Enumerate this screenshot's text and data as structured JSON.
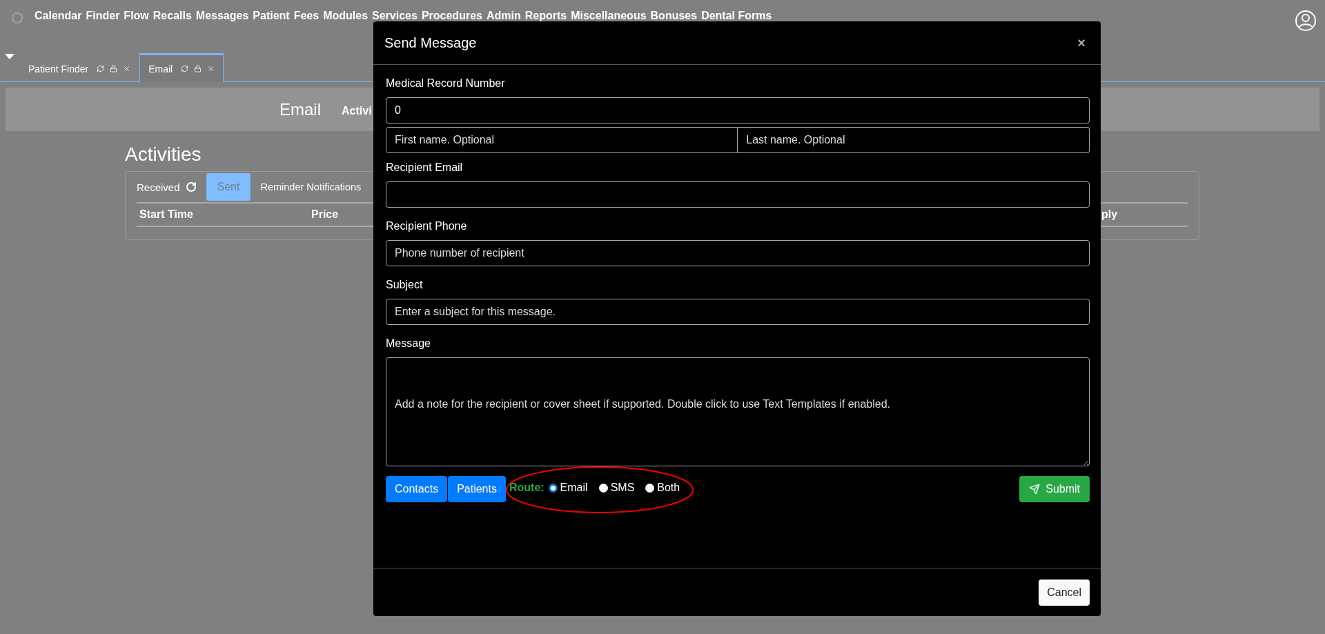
{
  "nav": {
    "items": [
      "Calendar",
      "Finder",
      "Flow",
      "Recalls",
      "Messages",
      "Patient",
      "Fees",
      "Modules",
      "Services",
      "Procedures",
      "Admin",
      "Reports",
      "Miscellaneous",
      "Bonuses",
      "Dental Forms"
    ]
  },
  "tabs": [
    {
      "label": "Patient Finder",
      "selected": false
    },
    {
      "label": "Email",
      "selected": true
    }
  ],
  "header": {
    "title": "Email",
    "subtitle": "Activi"
  },
  "activities": {
    "title": "Activities",
    "filters": [
      {
        "label": "Received",
        "kind": "refresh",
        "selected": false
      },
      {
        "label": "Sent",
        "kind": "button",
        "selected": true
      },
      {
        "label": "Reminder Notifications",
        "kind": "plain",
        "selected": false
      }
    ],
    "columns": [
      "Start Time",
      "Price",
      "ply"
    ]
  },
  "modal": {
    "title": "Send Message",
    "close": "×",
    "mrn": {
      "label": "Medical Record Number",
      "value": "0"
    },
    "first_name": {
      "placeholder": "First name. Optional"
    },
    "last_name": {
      "placeholder": "Last name. Optional"
    },
    "email": {
      "label": "Recipient Email"
    },
    "phone": {
      "label": "Recipient Phone",
      "placeholder": "Phone number of recipient"
    },
    "subject": {
      "label": "Subject",
      "placeholder": "Enter a subject for this message."
    },
    "message": {
      "label": "Message",
      "placeholder": "Add a note for the recipient or cover sheet if supported. Double click to use Text Templates if enabled."
    },
    "buttons": [
      "Contacts",
      "Patients"
    ],
    "route": {
      "label": "Route:",
      "options": [
        {
          "label": "Email",
          "selected": true
        },
        {
          "label": "SMS",
          "selected": false
        },
        {
          "label": "Both",
          "selected": false
        }
      ]
    },
    "submit": "Submit",
    "cancel": "Cancel"
  }
}
